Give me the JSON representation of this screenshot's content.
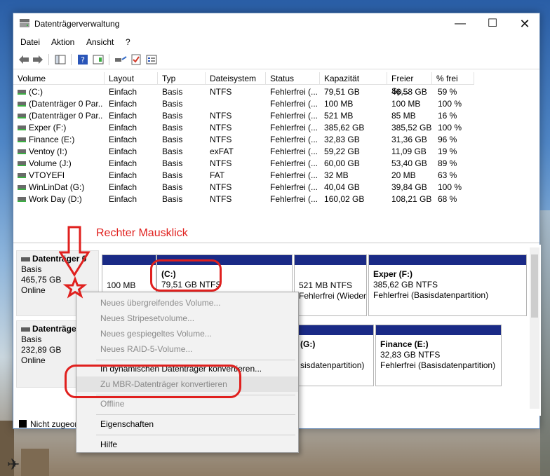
{
  "window": {
    "title": "Datenträgerverwaltung"
  },
  "menu": [
    "Datei",
    "Aktion",
    "Ansicht",
    "?"
  ],
  "columns": [
    "Volume",
    "Layout",
    "Typ",
    "Dateisystem",
    "Status",
    "Kapazität",
    "Freier Sp...",
    "% frei"
  ],
  "volumes": [
    {
      "name": "(C:)",
      "layout": "Einfach",
      "typ": "Basis",
      "fs": "NTFS",
      "status": "Fehlerfrei (...",
      "cap": "79,51 GB",
      "free": "46,58 GB",
      "pct": "59 %"
    },
    {
      "name": "(Datenträger 0 Par...",
      "layout": "Einfach",
      "typ": "Basis",
      "fs": "",
      "status": "Fehlerfrei (...",
      "cap": "100 MB",
      "free": "100 MB",
      "pct": "100 %"
    },
    {
      "name": "(Datenträger 0 Par...",
      "layout": "Einfach",
      "typ": "Basis",
      "fs": "NTFS",
      "status": "Fehlerfrei (...",
      "cap": "521 MB",
      "free": "85 MB",
      "pct": "16 %"
    },
    {
      "name": "Exper (F:)",
      "layout": "Einfach",
      "typ": "Basis",
      "fs": "NTFS",
      "status": "Fehlerfrei (...",
      "cap": "385,62 GB",
      "free": "385,52 GB",
      "pct": "100 %"
    },
    {
      "name": "Finance (E:)",
      "layout": "Einfach",
      "typ": "Basis",
      "fs": "NTFS",
      "status": "Fehlerfrei (...",
      "cap": "32,83 GB",
      "free": "31,36 GB",
      "pct": "96 %"
    },
    {
      "name": "Ventoy (I:)",
      "layout": "Einfach",
      "typ": "Basis",
      "fs": "exFAT",
      "status": "Fehlerfrei (...",
      "cap": "59,22 GB",
      "free": "11,09 GB",
      "pct": "19 %"
    },
    {
      "name": "Volume (J:)",
      "layout": "Einfach",
      "typ": "Basis",
      "fs": "NTFS",
      "status": "Fehlerfrei (...",
      "cap": "60,00 GB",
      "free": "53,40 GB",
      "pct": "89 %"
    },
    {
      "name": "VTOYEFI",
      "layout": "Einfach",
      "typ": "Basis",
      "fs": "FAT",
      "status": "Fehlerfrei (...",
      "cap": "32 MB",
      "free": "20 MB",
      "pct": "63 %"
    },
    {
      "name": "WinLinDat (G:)",
      "layout": "Einfach",
      "typ": "Basis",
      "fs": "NTFS",
      "status": "Fehlerfrei (...",
      "cap": "40,04 GB",
      "free": "39,84 GB",
      "pct": "100 %"
    },
    {
      "name": "Work Day (D:)",
      "layout": "Einfach",
      "typ": "Basis",
      "fs": "NTFS",
      "status": "Fehlerfrei (...",
      "cap": "160,02 GB",
      "free": "108,21 GB",
      "pct": "68 %"
    }
  ],
  "disks": [
    {
      "name": "Datenträger 0",
      "type": "Basis",
      "size": "465,75 GB",
      "state": "Online",
      "partitions": [
        {
          "title": "",
          "line1": "100 MB",
          "line2": ""
        },
        {
          "title": "(C:)",
          "line1": "79,51 GB NTFS",
          "line2": ""
        },
        {
          "title": "",
          "line1": "521 MB NTFS",
          "line2": "Fehlerfrei (Wieder"
        },
        {
          "title": "Exper  (F:)",
          "line1": "385,62 GB NTFS",
          "line2": "Fehlerfrei (Basisdatenpartition)"
        }
      ]
    },
    {
      "name": "Datenträger",
      "type": "Basis",
      "size": "232,89 GB",
      "state": "Online",
      "partitions": [
        {
          "title": "(G:)",
          "line1": "sisdatenpartition)",
          "line2": ""
        },
        {
          "title": "Finance  (E:)",
          "line1": "32,83 GB NTFS",
          "line2": "Fehlerfrei (Basisdatenpartition)"
        }
      ]
    }
  ],
  "legend": {
    "unallocated": "Nicht zugeor"
  },
  "context_menu": [
    {
      "label": "Neues übergreifendes Volume...",
      "enabled": false
    },
    {
      "label": "Neues Stripesetvolume...",
      "enabled": false
    },
    {
      "label": "Neues gespiegeltes Volume...",
      "enabled": false
    },
    {
      "label": "Neues RAID-5-Volume...",
      "enabled": false
    },
    {
      "label": "In dynamischen Datenträger konvertieren...",
      "enabled": true
    },
    {
      "label": "Zu MBR-Datenträger konvertieren",
      "enabled": false
    },
    {
      "label": "Offline",
      "enabled": false
    },
    {
      "label": "Eigenschaften",
      "enabled": true
    },
    {
      "label": "Hilfe",
      "enabled": true
    }
  ],
  "annotation": {
    "note": "Rechter Mausklick",
    "color": "#e0201e"
  },
  "colors": {
    "partition_bar": "#1a2a86",
    "accent_red": "#e0201e"
  }
}
